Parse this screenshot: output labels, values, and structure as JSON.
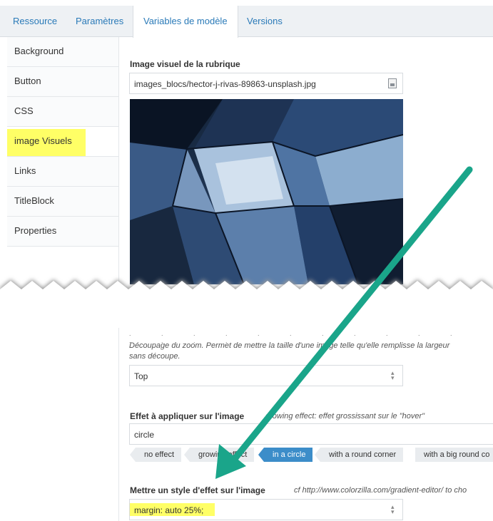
{
  "tabs": [
    {
      "label": "Ressource"
    },
    {
      "label": "Paramètres"
    },
    {
      "label": "Variables de modèle"
    },
    {
      "label": "Versions"
    }
  ],
  "sidebar": {
    "items": [
      {
        "label": "Background"
      },
      {
        "label": "Button"
      },
      {
        "label": "CSS"
      },
      {
        "label": "image Visuels"
      },
      {
        "label": "Links"
      },
      {
        "label": "TitleBlock"
      },
      {
        "label": "Properties"
      }
    ]
  },
  "image_field": {
    "label": "Image visuel de la rubrique",
    "value": "images_blocs/hector-j-rivas-89863-unsplash.jpg"
  },
  "zoom": {
    "description_line1": "Découpage du zoom. Permet de mettre la taille d'une image telle qu'elle remplisse la largeur",
    "description_line2": "sans découpe.",
    "select_value": "Top"
  },
  "effect": {
    "label": "Effet à appliquer sur l'image",
    "hint": "growing effect: effet grossissant sur le \"hover\"",
    "value": "circle",
    "tags": [
      "no effect",
      "growing effect",
      "in a circle",
      "with a round corner",
      "with a big round co"
    ]
  },
  "style_effect": {
    "label": "Mettre un style d'effet sur l'image",
    "hint": "cf http://www.colorzilla.com/gradient-editor/ to cho",
    "value": "margin: auto 25%;"
  },
  "colors": {
    "highlight": "#ffff66",
    "arrow": "#1aa58a",
    "accent": "#2a7ab8"
  }
}
